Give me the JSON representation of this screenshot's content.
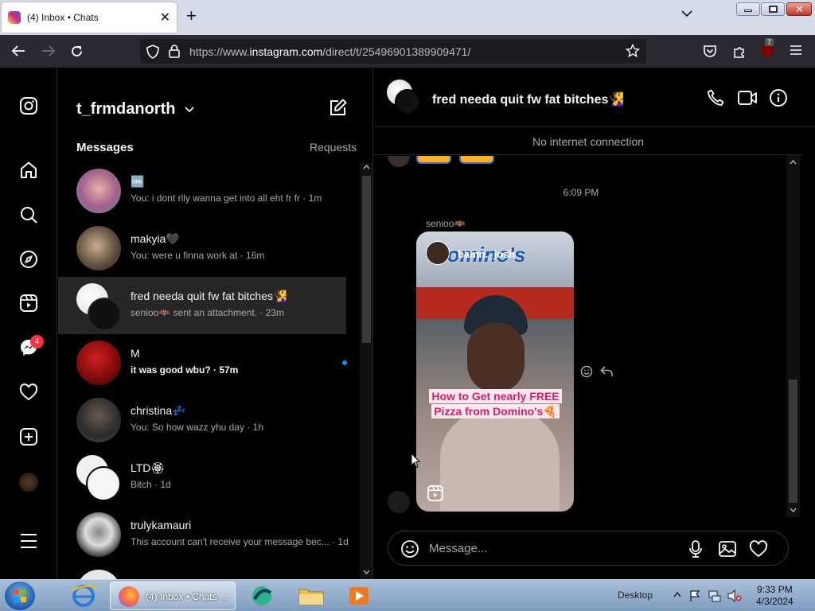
{
  "browser": {
    "tab_title": "(4) Inbox • Chats",
    "url_prefix": "https://www.",
    "url_domain": "instagram.com",
    "url_path": "/direct/t/25496901389909471/",
    "extension_badge": "7"
  },
  "sidebar": {
    "notification_badge": "4"
  },
  "inbox": {
    "username": "t_frmdanorth",
    "messages_heading": "Messages",
    "requests_label": "Requests",
    "threads": [
      {
        "name": "🆒",
        "preview": "You: i dont rlly wanna get into all eht fr fr · 1m",
        "unread": false,
        "selected": false
      },
      {
        "name": "makyia🖤",
        "preview": "You: were u finna work at · 16m",
        "unread": false,
        "selected": false
      },
      {
        "name": "fred needa quit fw fat bitches🧏‍♀️",
        "preview": "senioo🦇 sent an attachment. · 23m",
        "unread": false,
        "selected": true
      },
      {
        "name": "M",
        "preview": "it was good wbu? · 57m",
        "unread": true,
        "selected": false
      },
      {
        "name": "christina💤",
        "preview": "You: So how wazz yhu day · 1h",
        "unread": false,
        "selected": false
      },
      {
        "name": "LTD🏵",
        "preview": "Bitch · 1d",
        "unread": false,
        "selected": false
      },
      {
        "name": "trulykamauri",
        "preview": "This account can't receive your message bec... · 1d",
        "unread": false,
        "selected": false
      }
    ]
  },
  "chat": {
    "title": "fred needa quit fw fat bitches🧏‍♀️",
    "banner": "No internet connection",
    "timestamp": "6:09 PM",
    "sender": "senioo🦇",
    "reel": {
      "user": "bamn._josh",
      "caption": "How to Get nearly FREE Pizza from Domino's🍕",
      "sign_text": "Domino's"
    },
    "composer_placeholder": "Message..."
  },
  "taskbar": {
    "firefox_button": "(4) Inbox • Chats ...",
    "desktop_label": "Desktop",
    "time": "9:33 PM",
    "date": "4/3/2024"
  }
}
